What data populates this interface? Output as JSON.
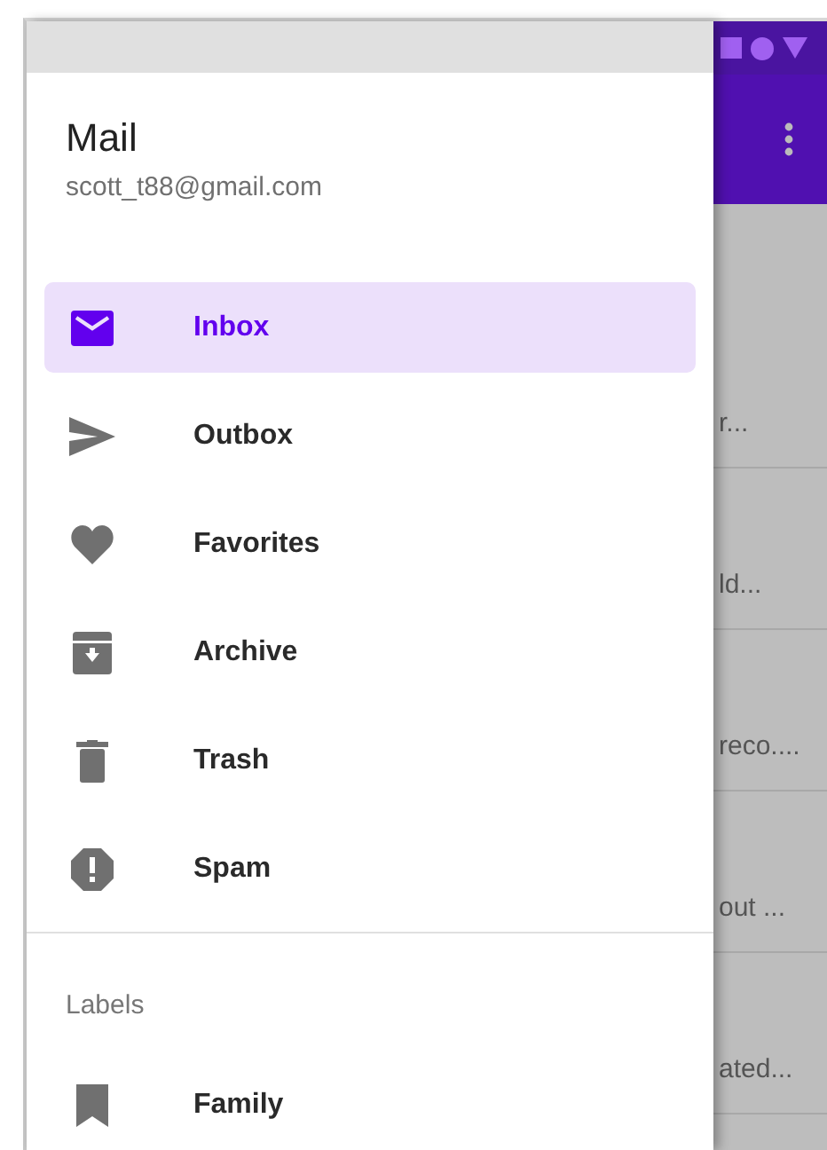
{
  "drawer": {
    "title": "Mail",
    "account": "scott_t88@gmail.com",
    "items": [
      {
        "label": "Inbox",
        "kind": "mail",
        "selected": true
      },
      {
        "label": "Outbox",
        "kind": "send",
        "selected": false
      },
      {
        "label": "Favorites",
        "kind": "heart",
        "selected": false
      },
      {
        "label": "Archive",
        "kind": "archive",
        "selected": false
      },
      {
        "label": "Trash",
        "kind": "trash",
        "selected": false
      },
      {
        "label": "Spam",
        "kind": "alert",
        "selected": false
      }
    ],
    "section_label": "Labels",
    "label_items": [
      {
        "label": "Family",
        "kind": "bookmark",
        "selected": false
      }
    ]
  },
  "background_list": {
    "rows": [
      "r...",
      "ld...",
      "reco....",
      "out ...",
      "ated..."
    ]
  }
}
